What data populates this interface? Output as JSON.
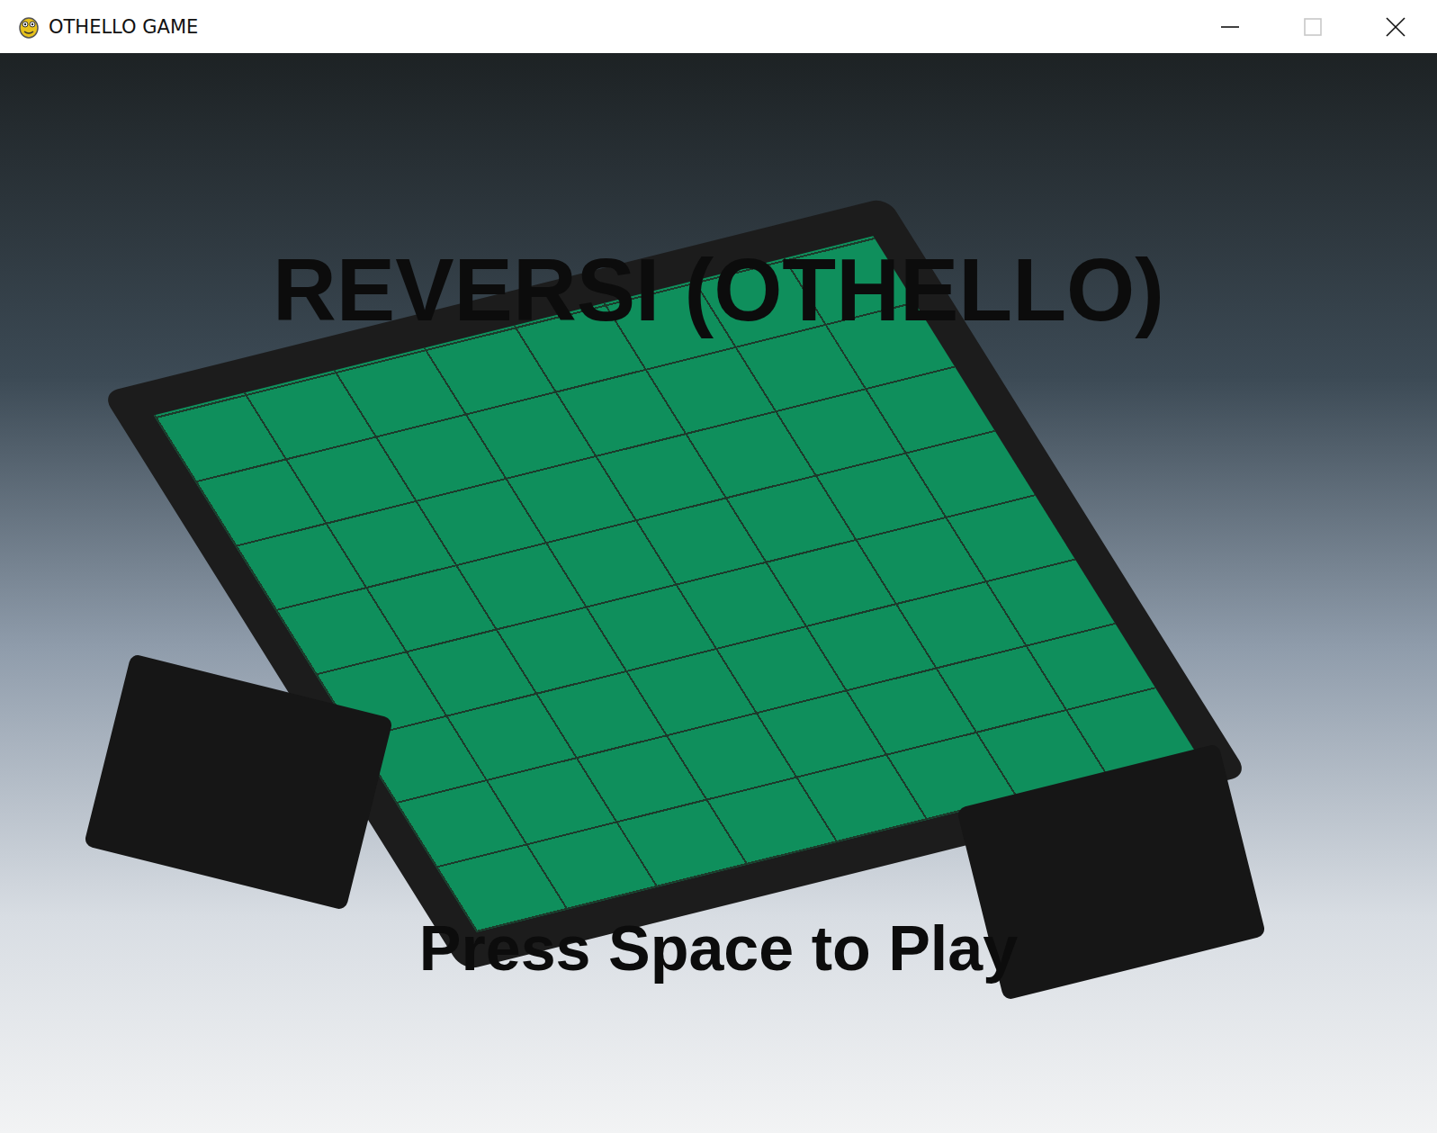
{
  "window": {
    "title": "OTHELLO GAME",
    "maximize_enabled": false
  },
  "screen": {
    "title": "REVERSI (OTHELLO)",
    "prompt": "Press Space to Play"
  }
}
